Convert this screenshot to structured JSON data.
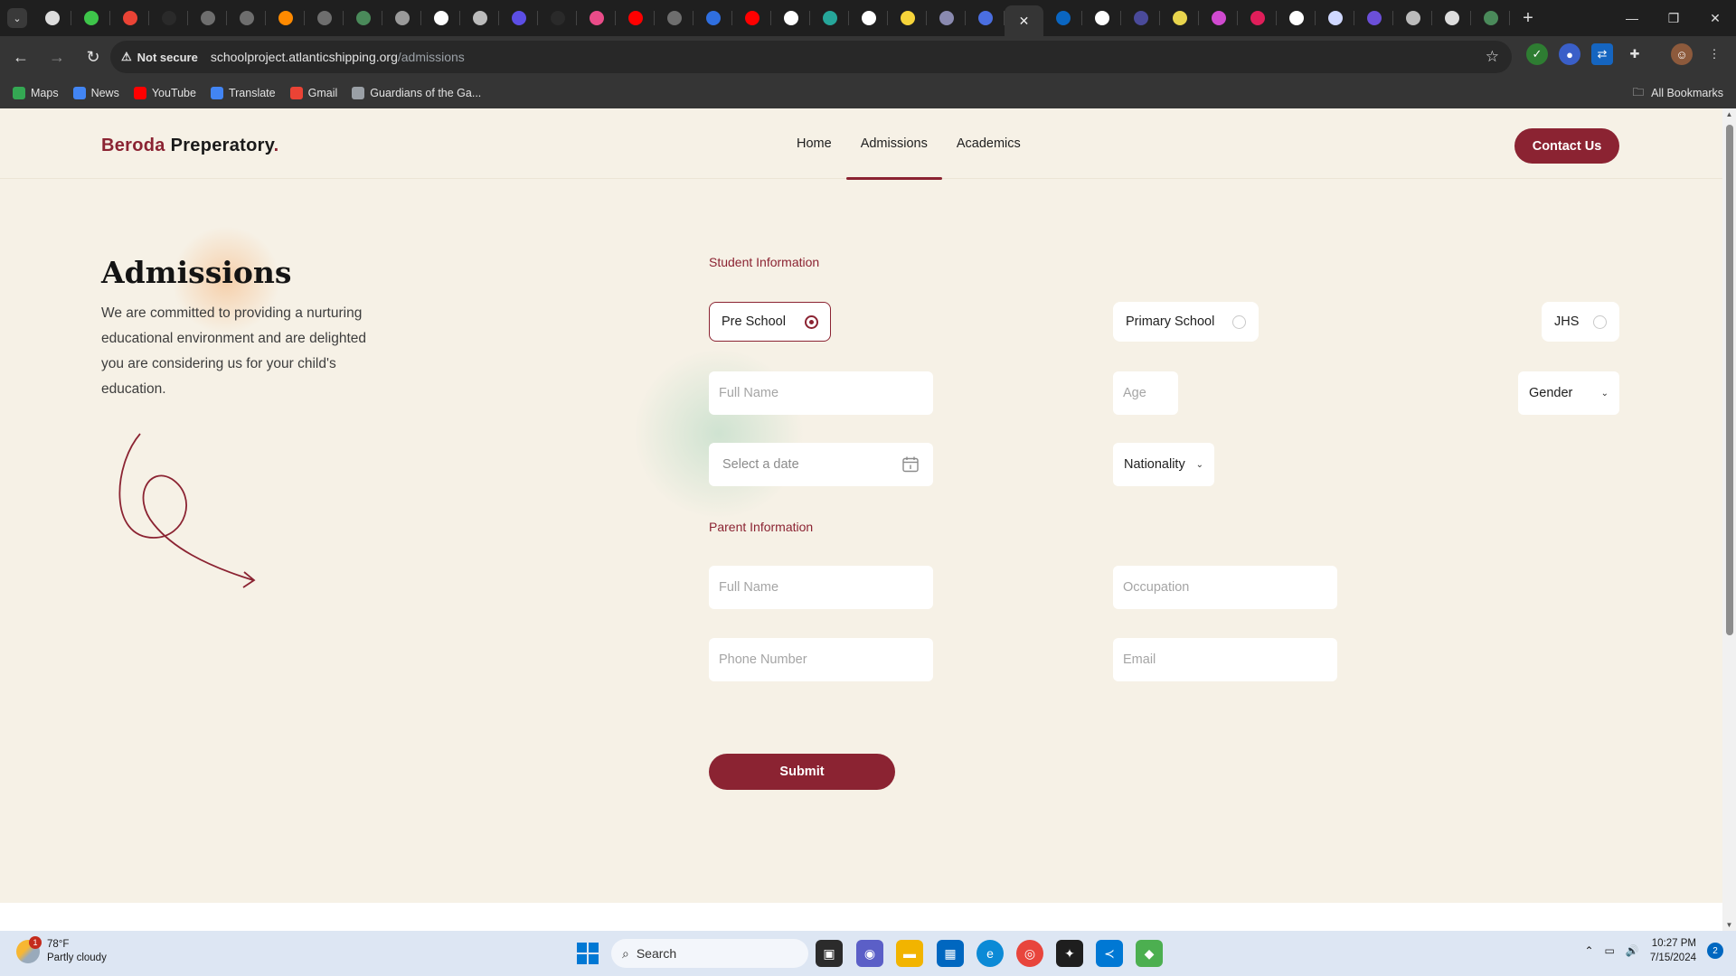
{
  "browser": {
    "tabs": [
      {
        "icon": "chrome-icon",
        "color": "#dddddd"
      },
      {
        "icon": "green-circle-icon",
        "color": "#3ec54a"
      },
      {
        "icon": "gmail-icon",
        "color": "#ea4335"
      },
      {
        "icon": "blank-icon",
        "color": "#2a2a2a"
      },
      {
        "icon": "github-icon",
        "color": "#6e6e6e"
      },
      {
        "icon": "github-icon",
        "color": "#6e6e6e"
      },
      {
        "icon": "fire-icon",
        "color": "#ff8a00"
      },
      {
        "icon": "github-icon",
        "color": "#6e6e6e"
      },
      {
        "icon": "loading-icon",
        "color": "#4a8a5a"
      },
      {
        "icon": "openai-icon",
        "color": "#9a9a9a"
      },
      {
        "icon": "notion-icon",
        "color": "#ffffff"
      },
      {
        "icon": "globe-icon",
        "color": "#bbbbbb"
      },
      {
        "icon": "hashnode-icon",
        "color": "#5c4ee5"
      },
      {
        "icon": "blank-icon",
        "color": "#2a2a2a"
      },
      {
        "icon": "dribbble-icon",
        "color": "#ea4c89"
      },
      {
        "icon": "youtube-icon",
        "color": "#ff0000"
      },
      {
        "icon": "github-icon",
        "color": "#6e6e6e"
      },
      {
        "icon": "terminal-icon",
        "color": "#2f6fe0"
      },
      {
        "icon": "youtube-icon",
        "color": "#ff0000"
      },
      {
        "icon": "vercel-icon",
        "color": "#ffffff"
      },
      {
        "icon": "openai-icon",
        "color": "#26a69a"
      },
      {
        "icon": "t-icon",
        "color": "#ffffff"
      },
      {
        "icon": "lemon-icon",
        "color": "#f6d43a"
      },
      {
        "icon": "circle-icon",
        "color": "#8a8ab0"
      },
      {
        "icon": "cube-icon",
        "color": "#4a6ee0"
      },
      {
        "icon": "close-icon",
        "color": "#eeeeee",
        "active": true
      },
      {
        "icon": "linkedin-icon",
        "color": "#0a66c2"
      },
      {
        "icon": "clock-icon",
        "color": "#ffffff"
      },
      {
        "icon": "circle-icon",
        "color": "#4a4a9a"
      },
      {
        "icon": "figure-icon",
        "color": "#e8d44d"
      },
      {
        "icon": "circle-icon",
        "color": "#d04ad0"
      },
      {
        "icon": "slack-icon",
        "color": "#e01e5a"
      },
      {
        "icon": "vercel-icon",
        "color": "#ffffff"
      },
      {
        "icon": "card-icon",
        "color": "#cfd8ff"
      },
      {
        "icon": "purple-square-icon",
        "color": "#6b4fd8"
      },
      {
        "icon": "circle-icon",
        "color": "#bbbbbb"
      },
      {
        "icon": "globe-icon",
        "color": "#dddddd"
      },
      {
        "icon": "infinity-icon",
        "color": "#4a8a5a"
      }
    ],
    "url_host": "schoolproject.atlanticshipping.org",
    "url_path": "/admissions",
    "security_label": "Not secure",
    "bookmarks": [
      {
        "label": "Maps",
        "color": "#34a853"
      },
      {
        "label": "News",
        "color": "#4285f4"
      },
      {
        "label": "YouTube",
        "color": "#ff0000"
      },
      {
        "label": "Translate",
        "color": "#4285f4"
      },
      {
        "label": "Gmail",
        "color": "#ea4335"
      },
      {
        "label": "Guardians of the Ga...",
        "color": "#9aa0a6"
      }
    ],
    "all_bookmarks_label": "All Bookmarks"
  },
  "site": {
    "logo_accent": "Beroda",
    "logo_main": "Preperatory",
    "logo_dot": ".",
    "nav": [
      {
        "label": "Home",
        "active": false
      },
      {
        "label": "Admissions",
        "active": true
      },
      {
        "label": "Academics",
        "active": false
      }
    ],
    "contact_label": "Contact Us",
    "brand_color": "#8b2332",
    "background": "#f6f1e6"
  },
  "intro": {
    "title": "Admissions",
    "description": "We are committed to providing a nurturing educational environment and are delighted you are considering us for your child's education."
  },
  "form": {
    "student_section": "Student Information",
    "school_levels": [
      {
        "label": "Pre School",
        "selected": true
      },
      {
        "label": "Primary School",
        "selected": false
      },
      {
        "label": "JHS",
        "selected": false
      }
    ],
    "student_full_name_placeholder": "Full Name",
    "age_placeholder": "Age",
    "gender_label": "Gender",
    "date_placeholder": "Select a date",
    "nationality_label": "Nationality",
    "parent_section": "Parent Information",
    "parent_full_name_placeholder": "Full Name",
    "occupation_placeholder": "Occupation",
    "phone_placeholder": "Phone Number",
    "email_placeholder": "Email",
    "submit_label": "Submit"
  },
  "taskbar": {
    "temperature": "78°F",
    "weather": "Partly cloudy",
    "weather_badge": "1",
    "search_label": "Search",
    "time": "10:27 PM",
    "date": "7/15/2024",
    "notifications": "2"
  }
}
